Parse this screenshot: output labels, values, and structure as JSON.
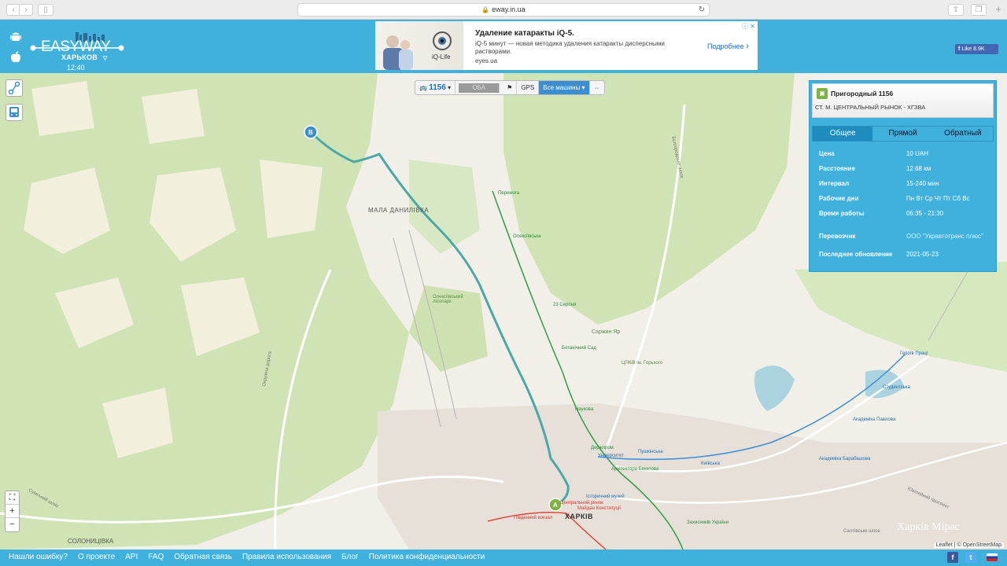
{
  "browser": {
    "url": "eway.in.ua",
    "back_icon": "chevron-left-icon",
    "forward_icon": "chevron-right-icon"
  },
  "header": {
    "logo_text": "EASYWAY",
    "city": "ХАРЬКОВ",
    "time": "12:40",
    "fb_like": "Like 8.9K"
  },
  "ad": {
    "title": "Удаление катаракты iQ-5.",
    "description": "iQ-5 минут — новая методика удаления катаракты дисперсными растворами.",
    "domain": "eyes.ua",
    "more": "Подробнее",
    "brand": "iQ-Life"
  },
  "toolbar": {
    "route_number": "1156",
    "oba": "ОБА",
    "gps": "GPS",
    "all_vehicles": "Все машины"
  },
  "route_panel": {
    "title": "Пригородный 1156",
    "subtitle": "СТ. М. ЦЕНТРАЛЬНЫЙ РЫНОК - ХГЗВА",
    "tabs": [
      "Общее",
      "Прямой",
      "Обратный"
    ],
    "rows": [
      {
        "k": "Цена",
        "v": "10 UAH"
      },
      {
        "k": "Расстояние",
        "v": "12.68 км"
      },
      {
        "k": "Интервал",
        "v": "15-240 мин"
      },
      {
        "k": "Рабочие дни",
        "v": "Пн Вт Ср Чт Пт Сб Вс"
      },
      {
        "k": "Время работы",
        "v": "06:35 - 21:30"
      },
      {
        "k": "Перевозчик",
        "v": "ООО \"Укравтотранс плюс\""
      },
      {
        "k": "Последнее обновление",
        "v": "2021-05-23"
      }
    ]
  },
  "map": {
    "marker_a": "A",
    "marker_b": "B",
    "labels": {
      "mala_danylivka": "МАЛА ДАНИЛІВКА",
      "kharkiv": "ХАРКІВ",
      "solonytsivka": "СОЛОНИЦІВКА",
      "peremoha": "Перемога",
      "oleksiivska": "Олексіївська",
      "serpnia": "23 Серпня",
      "botanichnyi": "Ботанічний Сад",
      "naukova": "Наукова",
      "derzhprom": "Держпром",
      "universytet": "Університет",
      "pushkinska": "Пушкінська",
      "arkhitektora": "Архітектора Бекетова",
      "istorychnyi": "Історичний музей",
      "tsentralnyi": "Центральний ринок",
      "maidan": "Майдан Конституції",
      "pivdennyi": "Південний вокзал",
      "zakhysnykiv": "Захисників України",
      "kyivska": "Київська",
      "akademika_barabashova": "Академіка Барабашова",
      "akademika_pavlova": "Академіка Павлова",
      "studentska": "Студентська",
      "heroiv_pratsi": "Героїв Праці",
      "sarzhyn_yar": "Саржин Яр",
      "tspkio": "ЦПКіВ ім. Горького",
      "okruzhna": "Окружна дорога",
      "sumskyi": "Сумський шлях",
      "saltivske": "Салтівське шосе",
      "bilhorodske": "Бєлгородське шосе",
      "oleksiivskyi_park": "Олексіївський лісопарк",
      "yuvileinyi": "Ювілейний проспект",
      "watermark": "Харків Мірас"
    },
    "attribution": "Leaflet | © OpenStreetMap"
  },
  "footer": {
    "links": [
      "Нашли ошибку?",
      "О проекте",
      "API",
      "FAQ",
      "Обратная связь",
      "Правила использования",
      "Блог",
      "Политика конфиденциальности"
    ]
  },
  "colors": {
    "header": "#40b1dd",
    "route": "#4aa8a8",
    "metro_green": "#2ea043",
    "metro_red": "#e0483e",
    "metro_blue": "#3a8fd6"
  }
}
